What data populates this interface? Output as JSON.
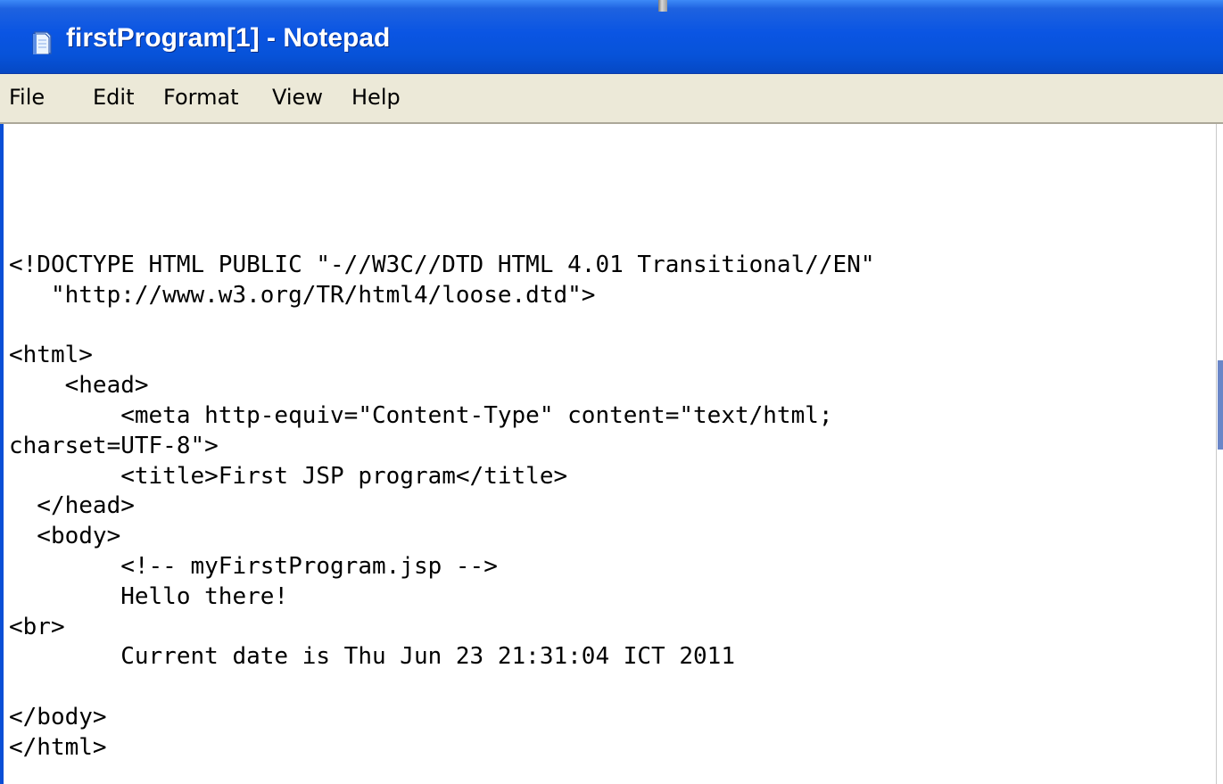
{
  "window": {
    "title": "firstProgram[1] - Notepad"
  },
  "menu": {
    "items": [
      "File",
      "Edit",
      "Format",
      "View",
      "Help"
    ]
  },
  "editor": {
    "lines": [
      "<!DOCTYPE HTML PUBLIC \"-//W3C//DTD HTML 4.01 Transitional//EN\"",
      "   \"http://www.w3.org/TR/html4/loose.dtd\">",
      "",
      "<html>",
      "    <head>",
      "        <meta http-equiv=\"Content-Type\" content=\"text/html;",
      "charset=UTF-8\">",
      "        <title>First JSP program</title>",
      "  </head>",
      "  <body>",
      "        <!-- myFirstProgram.jsp -->",
      "        Hello there!",
      "<br>",
      "        Current date is Thu Jun 23 21:31:04 ICT 2011",
      "",
      "</body>",
      "</html>"
    ]
  },
  "colors": {
    "titlebar": "#0a55e3",
    "menubar": "#ece9d8",
    "editor_bg": "#ffffff"
  },
  "icons": {
    "title": "notepad-icon"
  }
}
